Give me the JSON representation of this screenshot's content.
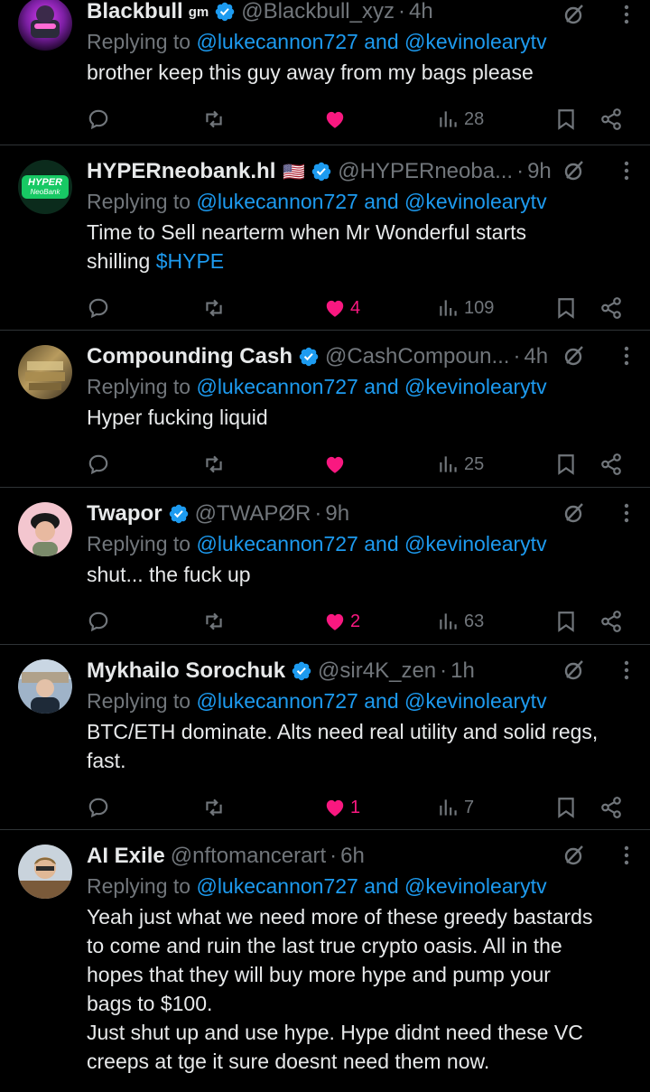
{
  "replies": [
    {
      "name": "Blackbull",
      "badge": "gm",
      "handle": "@Blackbull_xyz",
      "time": "4h",
      "replying_prefix": "Replying to",
      "mention1": "@lukecannon727",
      "and": "and",
      "mention2": "@kevinolearytv",
      "text": "brother keep this guy away from my bags please",
      "likes": "",
      "views": "28",
      "avatar_colors": [
        "#2a0d3f",
        "#e040fb"
      ]
    },
    {
      "name": "HYPERneobank.hl",
      "flag": "🇺🇸",
      "handle": "@HYPERneoba...",
      "time": "9h",
      "replying_prefix": "Replying to",
      "mention1": "@lukecannon727",
      "and": "and",
      "mention2": "@kevinolearytv",
      "text": "Time to Sell nearterm when Mr Wonderful starts",
      "text2": "shilling ",
      "cashtag": "$HYPE",
      "likes": "4",
      "views": "109",
      "avatar_text1": "HYPER",
      "avatar_text2": "NeoBank"
    },
    {
      "name": "Compounding Cash",
      "handle": "@CashCompoun...",
      "time": "4h",
      "replying_prefix": "Replying to",
      "mention1": "@lukecannon727",
      "and": "and",
      "mention2": "@kevinolearytv",
      "text": "Hyper fucking liquid",
      "likes": "",
      "views": "25"
    },
    {
      "name": "Twapor",
      "handle": "@TWAPØR",
      "time": "9h",
      "replying_prefix": "Replying to",
      "mention1": "@lukecannon727",
      "and": "and",
      "mention2": "@kevinolearytv",
      "text": "shut... the fuck up",
      "likes": "2",
      "views": "63"
    },
    {
      "name": "Mykhailo Sorochuk",
      "handle": "@sir4K_zen",
      "time": "1h",
      "replying_prefix": "Replying to",
      "mention1": "@lukecannon727",
      "and": "and",
      "mention2": "@kevinolearytv",
      "text": "BTC/ETH dominate. Alts need real utility and solid regs,\nfast.",
      "likes": "1",
      "views": "7"
    },
    {
      "name": "AI Exile",
      "handle": "@nftomancerart",
      "time": "6h",
      "replying_prefix": "Replying to",
      "mention1": "@lukecannon727",
      "and": "and",
      "mention2": "@kevinolearytv",
      "text": "Yeah just what we need more of these greedy bastards\nto come and ruin the last true crypto oasis. All in the\nhopes that they will buy more hype and pump your\nbags to $100.\nJust shut up and use hype. Hype didnt need these VC\ncreeps at tge it sure doesnt need them now."
    }
  ],
  "colors": {
    "background": "#000000",
    "text": "#e7e9ea",
    "muted": "#71767b",
    "link": "#1d9bf0",
    "like": "#f91880",
    "verified": "#1d9bf0",
    "divider": "#2f3336"
  }
}
